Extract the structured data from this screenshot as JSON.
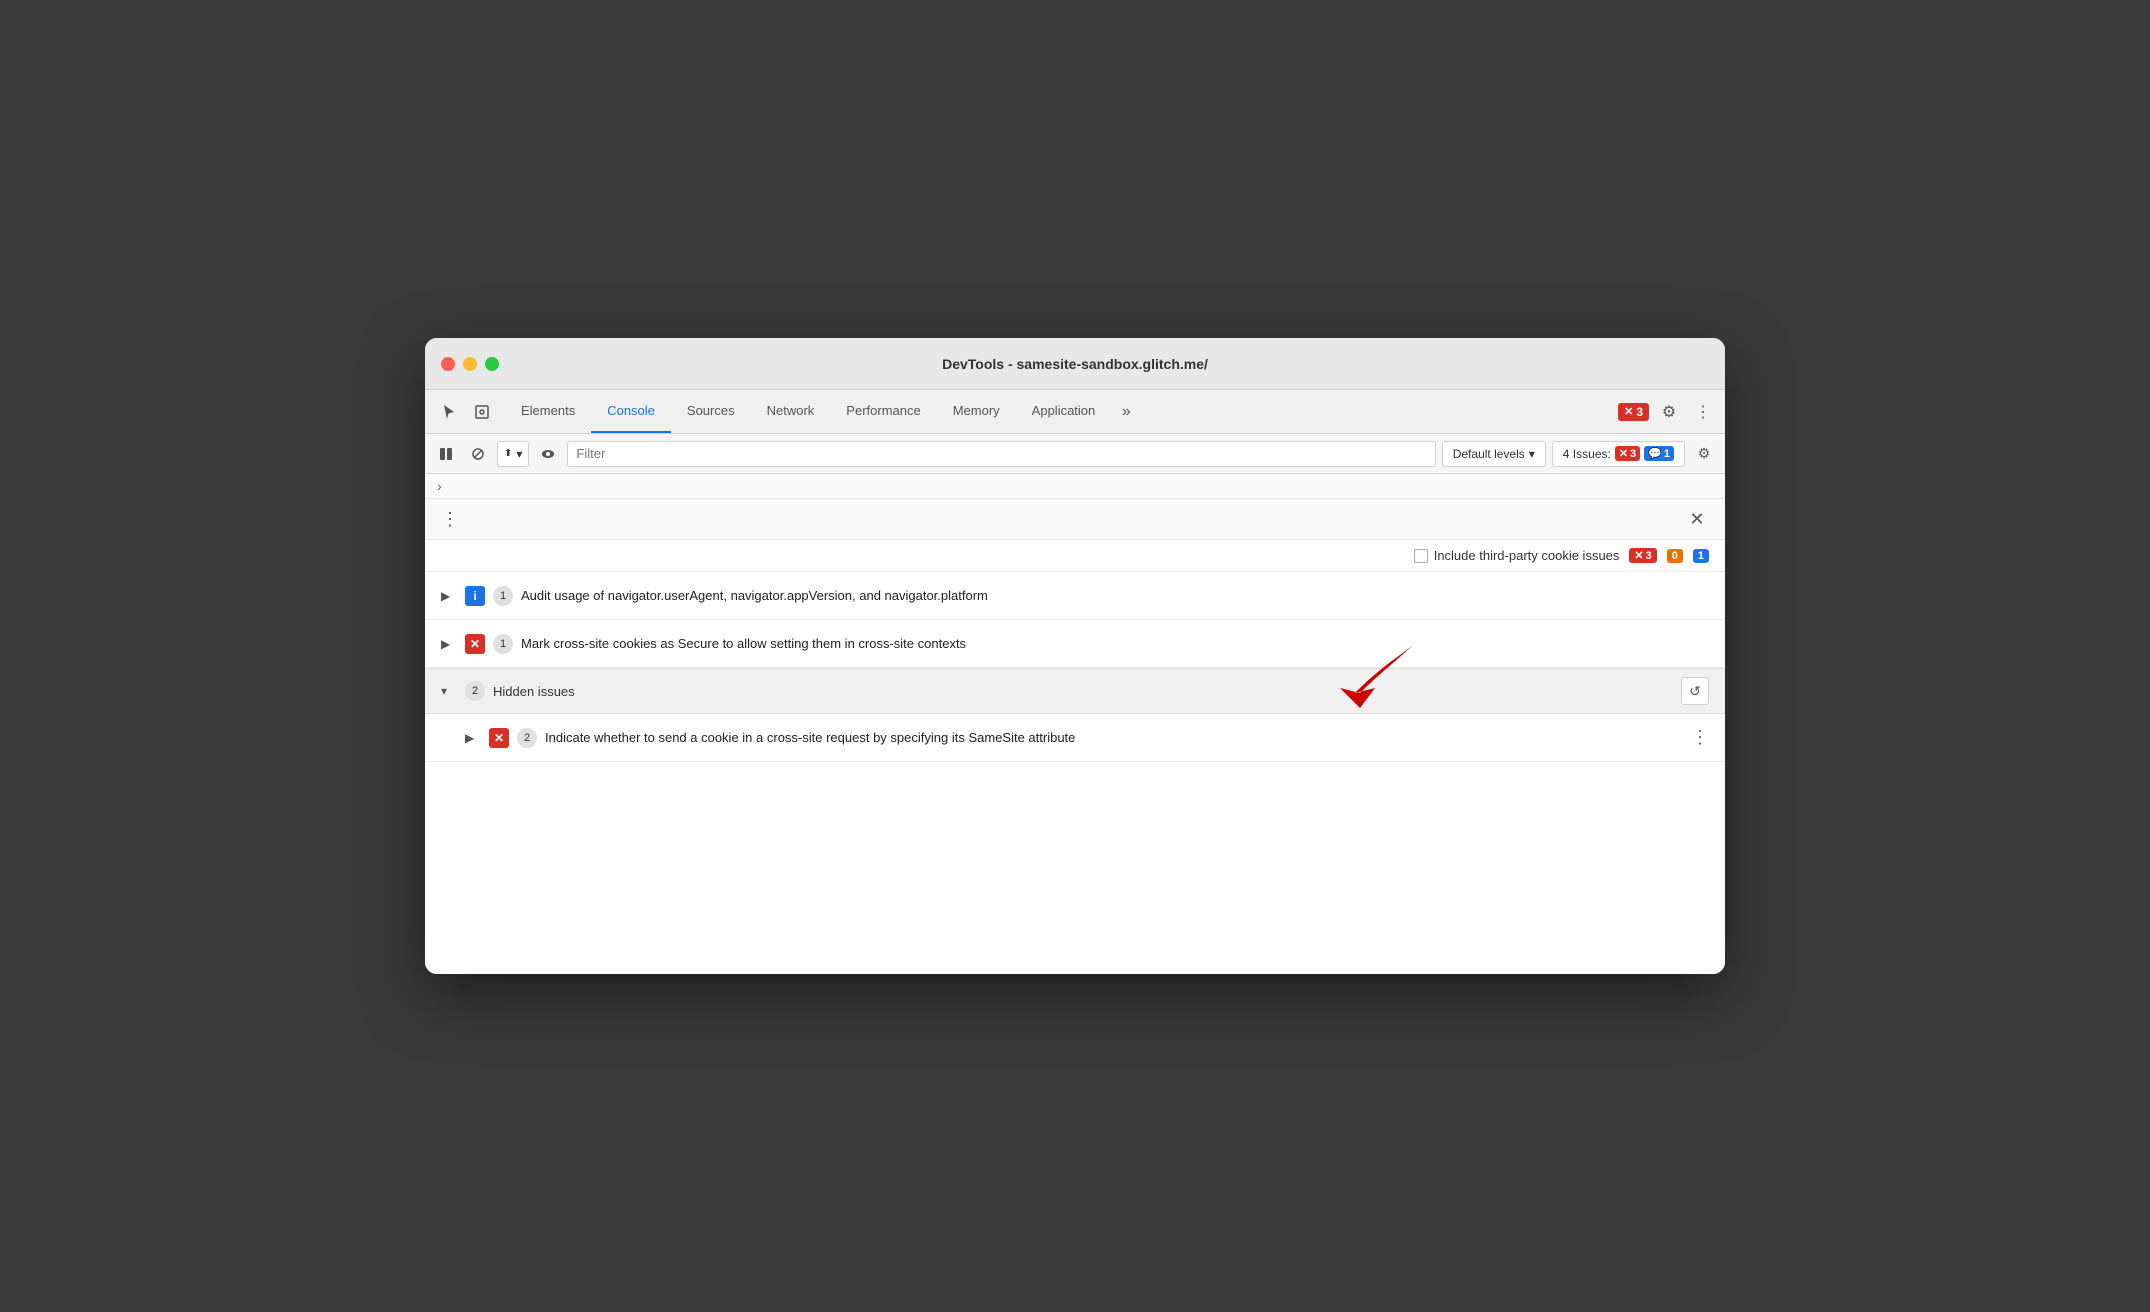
{
  "window": {
    "title": "DevTools - samesite-sandbox.glitch.me/"
  },
  "tabs": {
    "items": [
      {
        "label": "Elements",
        "active": false
      },
      {
        "label": "Console",
        "active": true
      },
      {
        "label": "Sources",
        "active": false
      },
      {
        "label": "Network",
        "active": false
      },
      {
        "label": "Performance",
        "active": false
      },
      {
        "label": "Memory",
        "active": false
      },
      {
        "label": "Application",
        "active": false
      }
    ],
    "more_label": "»",
    "error_count": "3"
  },
  "toolbar": {
    "filter_placeholder": "Filter",
    "default_levels_label": "Default levels",
    "issues_label": "4 Issues:",
    "issues_error_count": "3",
    "issues_info_count": "1"
  },
  "issues_panel": {
    "cookie_issues_label": "Include third-party cookie issues",
    "cookie_error_count": "3",
    "cookie_warning_count": "0",
    "cookie_info_count": "1"
  },
  "issues": [
    {
      "id": 1,
      "type": "info",
      "count": 1,
      "text": "Audit usage of navigator.userAgent, navigator.appVersion, and navigator.platform"
    },
    {
      "id": 2,
      "type": "error",
      "count": 1,
      "text": "Mark cross-site cookies as Secure to allow setting them in cross-site contexts"
    }
  ],
  "hidden_issues": {
    "label": "Hidden issues",
    "count": 2
  },
  "nested_issues": [
    {
      "id": 3,
      "type": "error",
      "count": 2,
      "text": "Indicate whether to send a cookie in a cross-site request by specifying its SameSite attribute"
    }
  ],
  "icons": {
    "cursor": "⬆",
    "inspect": "◻",
    "play": "▶",
    "ban": "⊘",
    "eye": "👁",
    "chevron_down": "▾",
    "chevron_right": "▶",
    "chevron_left": "◀",
    "kebab": "⋮",
    "close": "✕",
    "gear": "⚙",
    "more": "≫",
    "refresh": "↺",
    "error_x": "✕",
    "info_i": "i"
  }
}
